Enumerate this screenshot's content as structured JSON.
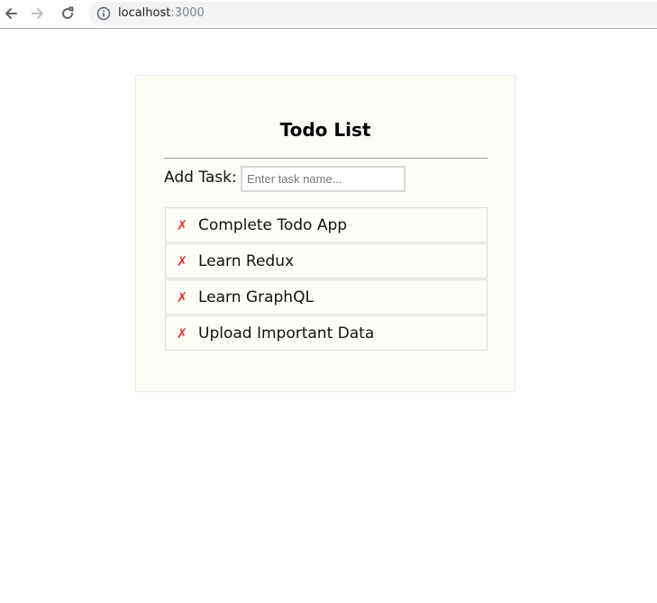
{
  "browser": {
    "url_host": "localhost",
    "url_port": ":3000",
    "icons": [
      "back-arrow-icon",
      "forward-arrow-icon",
      "reload-icon",
      "info-icon"
    ]
  },
  "app": {
    "title": "Todo List",
    "add_label": "Add Task:",
    "input": {
      "value": "",
      "placeholder": "Enter task name..."
    },
    "tasks": [
      {
        "label": "Complete Todo App",
        "delete_glyph": "✗"
      },
      {
        "label": "Learn Redux",
        "delete_glyph": "✗"
      },
      {
        "label": "Learn GraphQL",
        "delete_glyph": "✗"
      },
      {
        "label": "Upload Important Data",
        "delete_glyph": "✗"
      }
    ]
  },
  "colors": {
    "delete_icon": "#e53935",
    "card_background": "#fffdf8",
    "card_border": "#ececec",
    "address_bar": "#f1f3f4"
  }
}
